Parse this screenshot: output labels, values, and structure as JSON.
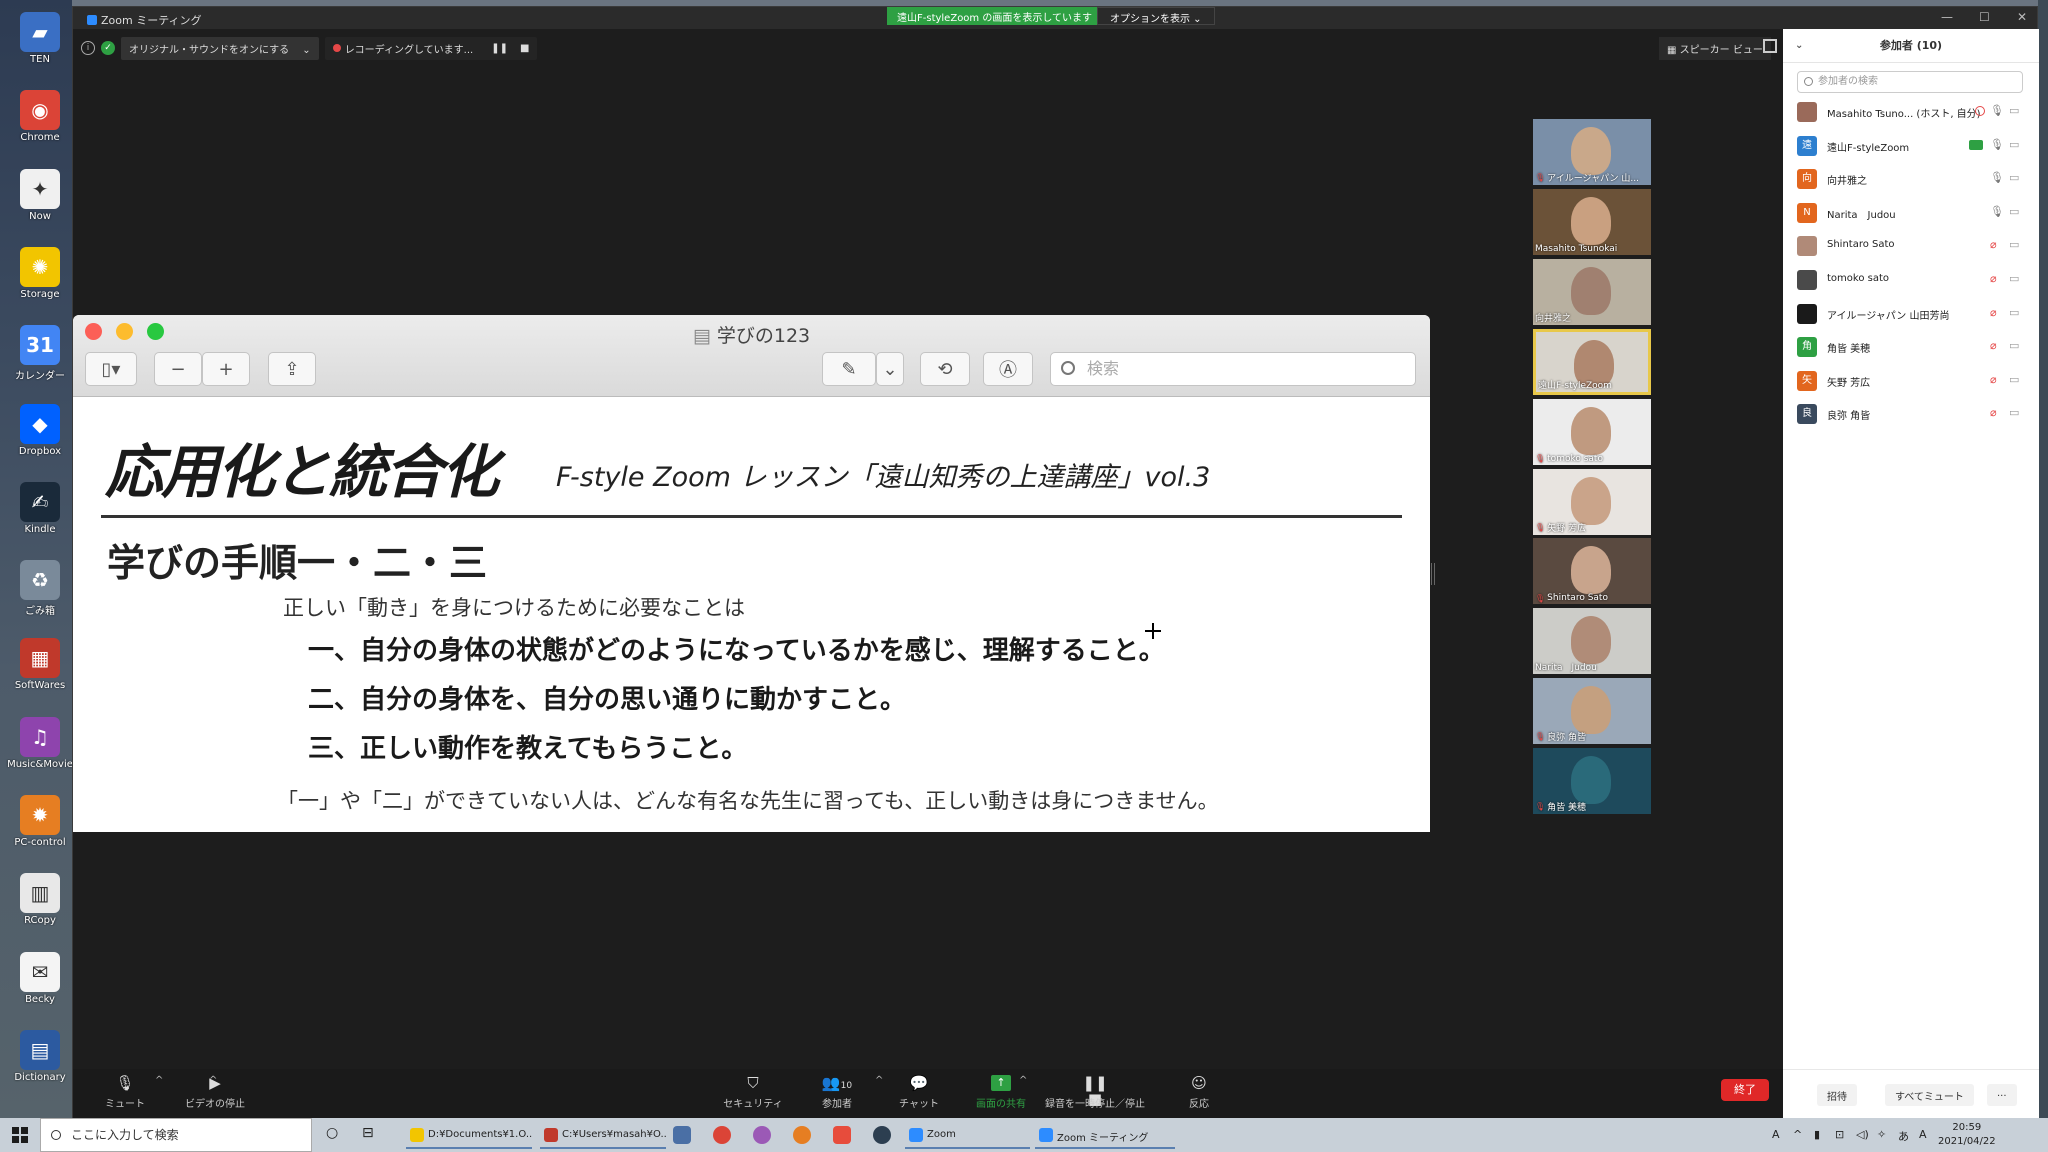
{
  "desktop": {
    "icons": [
      {
        "label": "TEN",
        "color": "#3a6fc4",
        "glyph": "▰"
      },
      {
        "label": "Chrome",
        "color": "#db4437",
        "glyph": "◉"
      },
      {
        "label": "Now",
        "color": "#f0f0f0",
        "glyph": "✦"
      },
      {
        "label": "Storage",
        "color": "#f2c500",
        "glyph": "✺"
      },
      {
        "label": "カレンダー",
        "color": "#4285f4",
        "glyph": "31"
      },
      {
        "label": "Dropbox",
        "color": "#0061ff",
        "glyph": "◆"
      },
      {
        "label": "Kindle",
        "color": "#1a2a3a",
        "glyph": "✍"
      },
      {
        "label": "ごみ箱",
        "color": "#7a8a9a",
        "glyph": "♻"
      },
      {
        "label": "SoftWares",
        "color": "#c0392b",
        "glyph": "▦"
      },
      {
        "label": "Music&Movie",
        "color": "#8e44ad",
        "glyph": "♫"
      },
      {
        "label": "PC-control",
        "color": "#e67e22",
        "glyph": "✹"
      },
      {
        "label": "RCopy",
        "color": "#e8e8e8",
        "glyph": "▥"
      },
      {
        "label": "Becky",
        "color": "#f4f4f4",
        "glyph": "✉"
      },
      {
        "label": "Dictionary",
        "color": "#2c5aa0",
        "glyph": "▤"
      }
    ]
  },
  "zoom": {
    "window_title": "Zoom ミーティング",
    "share_banner": "遠山F-styleZoom の画面を表示しています",
    "options_label": "オプションを表示 ⌄",
    "minimize": "—",
    "maximize": "☐",
    "close": "✕",
    "toolbar": {
      "info_icon": "i",
      "shield_icon": "✓",
      "original_sound": "オリジナル・サウンドをオンにする",
      "sound_caret": "⌄",
      "recording": "レコーディングしています...",
      "pause": "❚❚",
      "stop": "■",
      "speaker_view": "スピーカー ビュー"
    }
  },
  "preview": {
    "title": "学びの123",
    "search_placeholder": "検索",
    "buttons": {
      "sidebar": "▯▾",
      "zoom_out": "−",
      "zoom_in": "+",
      "share": "⇪",
      "pen": "✎",
      "pen_menu": "⌄",
      "rotate": "⟲",
      "markup": "Ⓐ"
    }
  },
  "slide": {
    "main_title": "応用化と統合化",
    "sub_title": "F-style Zoom レッスン「遠山知秀の上達講座」vol.3",
    "heading": "学びの手順一・二・三",
    "intro": "正しい「動き」を身につけるために必要なことは",
    "items": [
      "一、自分の身体の状態がどのようになっているかを感じ、理解すること。",
      "二、自分の身体を、自分の思い通りに動かすこと。",
      "三、正しい動作を教えてもらうこと。"
    ],
    "footnote": "「一」や「二」ができていない人は、どんな有名な先生に習っても、正しい動きは身につきません。"
  },
  "video_tiles": [
    {
      "name": "アイルージャパン 山...",
      "muted": true,
      "bg": "#7a8fa8",
      "skin": "#c9a88a"
    },
    {
      "name": "Masahito Tsunokai",
      "muted": false,
      "bg": "#6b5238",
      "skin": "#c9a080"
    },
    {
      "name": "向井雅之",
      "muted": false,
      "bg": "#b8b0a0",
      "skin": "#a08070"
    },
    {
      "name": "遠山F-styleZoom",
      "muted": false,
      "bg": "#d8d4cc",
      "skin": "#b08870"
    },
    {
      "name": "tomoko sato",
      "muted": true,
      "bg": "#ececec",
      "skin": "#c09a80"
    },
    {
      "name": "矢野 芳広",
      "muted": true,
      "bg": "#e8e4e0",
      "skin": "#caa48a"
    },
    {
      "name": "Shintaro Sato",
      "muted": true,
      "bg": "#5a4a40",
      "skin": "#c8a48c"
    },
    {
      "name": "Narita　Judou",
      "muted": false,
      "bg": "#ccccc8",
      "skin": "#b08c78"
    },
    {
      "name": "良弥 角皆",
      "muted": true,
      "bg": "#9aa8b8",
      "skin": "#c4a080"
    },
    {
      "name": "角皆 美穂",
      "muted": true,
      "bg": "#1e4a5c",
      "skin": "#2a6a7a"
    }
  ],
  "bottom_bar": {
    "mute": "ミュート",
    "video": "ビデオの停止",
    "security": "セキュリティ",
    "participants": "参加者",
    "participant_count": "10",
    "chat": "チャット",
    "share": "画面の共有",
    "record": "録音を一時停止／停止",
    "reactions": "反応",
    "end": "終了",
    "caret": "^"
  },
  "participants_panel": {
    "title": "参加者 (10)",
    "collapse": "⌄",
    "search_placeholder": "参加者の検索",
    "list": [
      {
        "name": "Masahito Tsuno...  (ホスト, 自分)",
        "avatar": "",
        "avatar_color": "#9a6a5a",
        "mic_off": false,
        "recording": true,
        "sharing": false
      },
      {
        "name": "遠山F-styleZoom",
        "avatar": "遠",
        "avatar_color": "#2d7fcf",
        "mic_off": false,
        "recording": false,
        "sharing": true
      },
      {
        "name": "向井雅之",
        "avatar": "向",
        "avatar_color": "#e2661e",
        "mic_off": false,
        "recording": false,
        "sharing": false
      },
      {
        "name": "Narita　Judou",
        "avatar": "N",
        "avatar_color": "#e2661e",
        "mic_off": false,
        "recording": false,
        "sharing": false
      },
      {
        "name": "Shintaro Sato",
        "avatar": "",
        "avatar_color": "#b08a78",
        "mic_off": true,
        "recording": false,
        "sharing": false
      },
      {
        "name": "tomoko sato",
        "avatar": "",
        "avatar_color": "#4a4a4a",
        "mic_off": true,
        "recording": false,
        "sharing": false
      },
      {
        "name": "アイルージャパン 山田芳尚",
        "avatar": "",
        "avatar_color": "#1a1a1a",
        "mic_off": true,
        "recording": false,
        "sharing": false
      },
      {
        "name": "角皆 美穂",
        "avatar": "角",
        "avatar_color": "#2ea043",
        "mic_off": true,
        "recording": false,
        "sharing": false
      },
      {
        "name": "矢野 芳広",
        "avatar": "矢",
        "avatar_color": "#e2661e",
        "mic_off": true,
        "recording": false,
        "sharing": false
      },
      {
        "name": "良弥 角皆",
        "avatar": "良",
        "avatar_color": "#3a4a5e",
        "mic_off": true,
        "recording": false,
        "sharing": false
      }
    ],
    "invite": "招待",
    "mute_all": "すべてミュート",
    "more": "..."
  },
  "taskbar": {
    "search_placeholder": "ここに入力して検索",
    "task_view": "○",
    "multitask": "⊟",
    "apps": [
      {
        "label": "D:¥Documents¥1.O...",
        "color": "#f2c500"
      },
      {
        "label": "C:¥Users¥masah¥O...",
        "color": "#c0392b"
      },
      {
        "label": "Zoom",
        "color": "#2d8cff"
      },
      {
        "label": "Zoom ミーティング",
        "color": "#2d8cff"
      }
    ],
    "time": "20:59",
    "date": "2021/04/22",
    "tray_icons": [
      "A",
      "^",
      "▮",
      "⊡",
      "◁)",
      "✧",
      "あ",
      "A"
    ]
  }
}
